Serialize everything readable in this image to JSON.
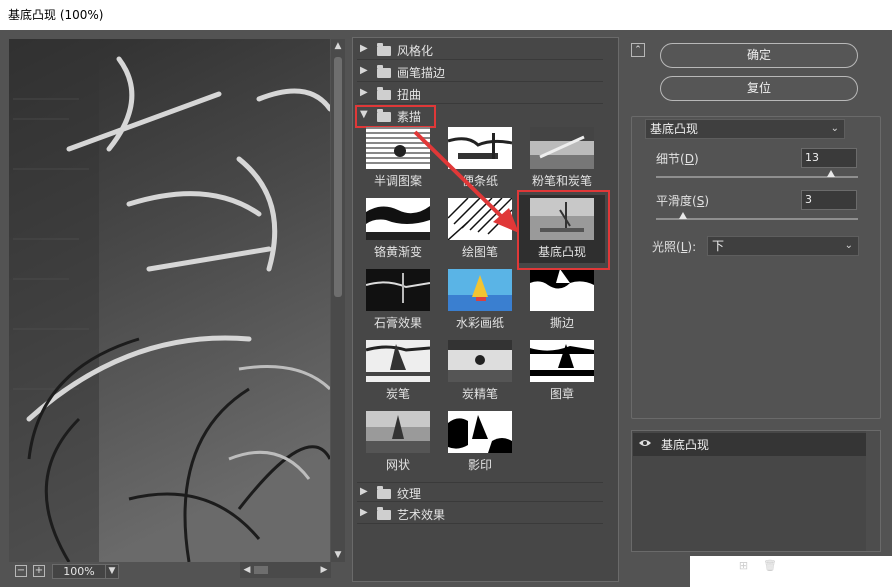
{
  "window": {
    "title": "基底凸现 (100%)"
  },
  "preview": {
    "zoom": "100%"
  },
  "gallery": {
    "categories_top": [
      {
        "label": "风格化",
        "expanded": false
      },
      {
        "label": "画笔描边",
        "expanded": false
      },
      {
        "label": "扭曲",
        "expanded": false
      },
      {
        "label": "素描",
        "expanded": true
      }
    ],
    "filters": [
      {
        "label": "半调图案"
      },
      {
        "label": "便条纸"
      },
      {
        "label": "粉笔和炭笔"
      },
      {
        "label": "铬黄渐变"
      },
      {
        "label": "绘图笔"
      },
      {
        "label": "基底凸现",
        "selected": true
      },
      {
        "label": "石膏效果"
      },
      {
        "label": "水彩画纸"
      },
      {
        "label": "撕边"
      },
      {
        "label": "炭笔"
      },
      {
        "label": "炭精笔"
      },
      {
        "label": "图章"
      },
      {
        "label": "网状"
      },
      {
        "label": "影印"
      }
    ],
    "categories_bottom": [
      {
        "label": "纹理",
        "expanded": false
      },
      {
        "label": "艺术效果",
        "expanded": false
      }
    ]
  },
  "buttons": {
    "ok": "确定",
    "reset": "复位"
  },
  "settings": {
    "filter": "基底凸现",
    "detail": {
      "label": "细节",
      "key": "D",
      "value": "13",
      "level": 0.867
    },
    "smoothness": {
      "label": "平滑度",
      "key": "S",
      "value": "3",
      "level": 0.133
    },
    "light": {
      "label": "光照",
      "key": "L",
      "value": "下"
    }
  },
  "layers": {
    "items": [
      {
        "name": "基底凸现"
      }
    ]
  },
  "colors": {
    "highlight": "#e03838",
    "arrow": "#e03838",
    "selected_bg": "#2f2f2f"
  }
}
